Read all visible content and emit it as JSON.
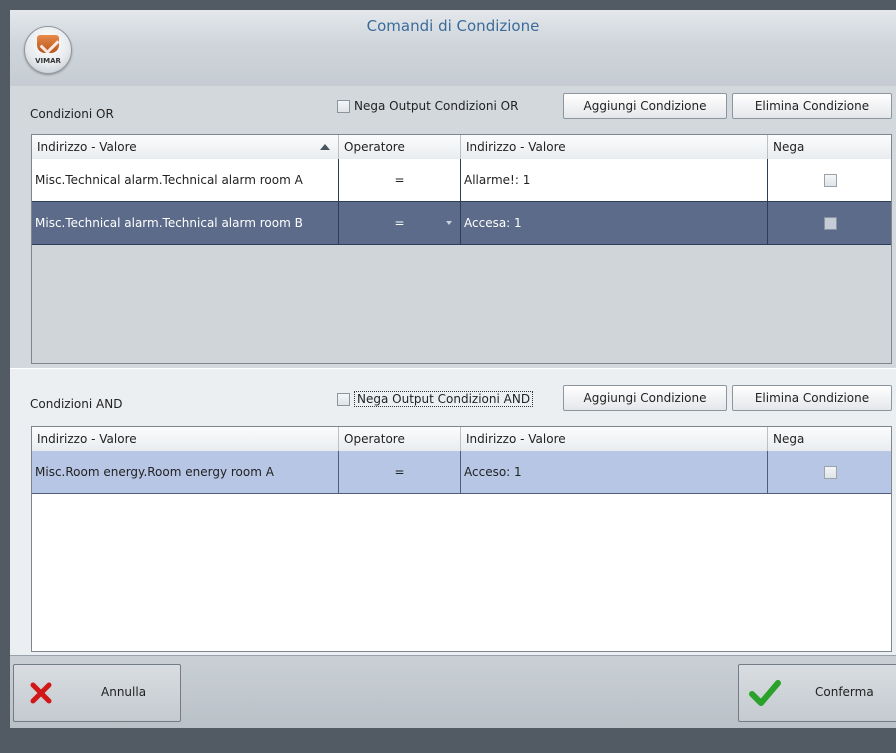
{
  "window": {
    "title": "Comandi di Condizione",
    "brand": "VIMAR",
    "colors": {
      "title": "#3b6b9a",
      "selected_row_dark": "#5b6b89",
      "selected_row_light": "#b7c6e5"
    }
  },
  "or_section": {
    "label": "Condizioni OR",
    "negate_label": "Nega Output Condizioni OR",
    "add_button": "Aggiungi Condizione",
    "remove_button": "Elimina Condizione",
    "columns": [
      "Indirizzo - Valore",
      "Operatore",
      "Indirizzo - Valore",
      "Nega"
    ],
    "rows": [
      {
        "address": "Misc.Technical alarm.Technical alarm room A",
        "operator": "=",
        "value": "Allarme!: 1",
        "negate": false
      },
      {
        "address": "Misc.Technical alarm.Technical alarm room B",
        "operator": "=",
        "value": "Accesa: 1",
        "negate": false
      }
    ]
  },
  "and_section": {
    "label": "Condizioni AND",
    "negate_label": "Nega Output Condizioni AND",
    "add_button": "Aggiungi Condizione",
    "remove_button": "Elimina Condizione",
    "columns": [
      "Indirizzo - Valore",
      "Operatore",
      "Indirizzo - Valore",
      "Nega"
    ],
    "rows": [
      {
        "address": "Misc.Room energy.Room energy room A",
        "operator": "=",
        "value": "Acceso: 1",
        "negate": false
      }
    ]
  },
  "footer": {
    "cancel_label": "Annulla",
    "confirm_label": "Conferma",
    "icons": {
      "cancel": "red-x-icon",
      "confirm": "green-check-icon"
    }
  }
}
